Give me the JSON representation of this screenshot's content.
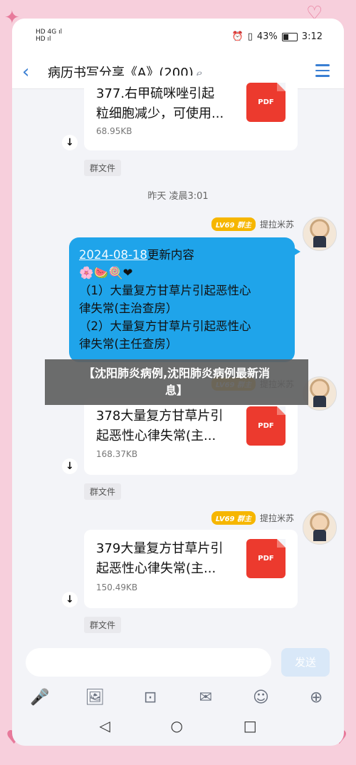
{
  "status": {
    "left_top": "HD 4G ıl",
    "left_bottom": "HD ıl",
    "alarm": "⏰",
    "vibrate": "▯",
    "battery_pct": "43%",
    "time": "3:12"
  },
  "header": {
    "back_icon": "‹",
    "title": "病历书写分享《A》(200)",
    "ear_icon": "ℯ"
  },
  "messages": {
    "file1": {
      "name_line1": "377.右甲硫咪唑引起",
      "name_line2": "粒细胞减少，可使用...",
      "size": "68.95KB",
      "source": "群文件"
    },
    "timestamp": "昨天 凌晨3:01",
    "sender_level": "LV69 群主",
    "sender_name": "提拉米苏",
    "text_bubble": {
      "date": "2024-08-18",
      "title_rest": "更新内容",
      "emojis": "🌸🍉🍭❤",
      "line1": "（1）大量复方甘草片引起恶性心",
      "line2": "律失常(主治查房）",
      "line3": "（2）大量复方甘草片引起恶性心",
      "line4": "律失常(主任查房）"
    },
    "file2": {
      "name_line1": "378大量复方甘草片引",
      "name_line2": "起恶性心律失常(主...",
      "size": "168.37KB",
      "source": "群文件"
    },
    "file3": {
      "name_line1": "379大量复方甘草片引",
      "name_line2": "起恶性心律失常(主...",
      "size": "150.49KB",
      "source": "群文件"
    },
    "pdf_label": "PDF",
    "download_icon": "↓"
  },
  "overlay_text_line1": "【沈阳肺炎病例,沈阳肺炎病例最新消",
  "overlay_text_line2": "息】",
  "input": {
    "send_label": "发送"
  },
  "tools": [
    "🎤",
    "🖼",
    "⊡",
    "✉",
    "☺",
    "⊕"
  ],
  "nav": {
    "back": "◁",
    "home": "○",
    "recent": "□"
  }
}
